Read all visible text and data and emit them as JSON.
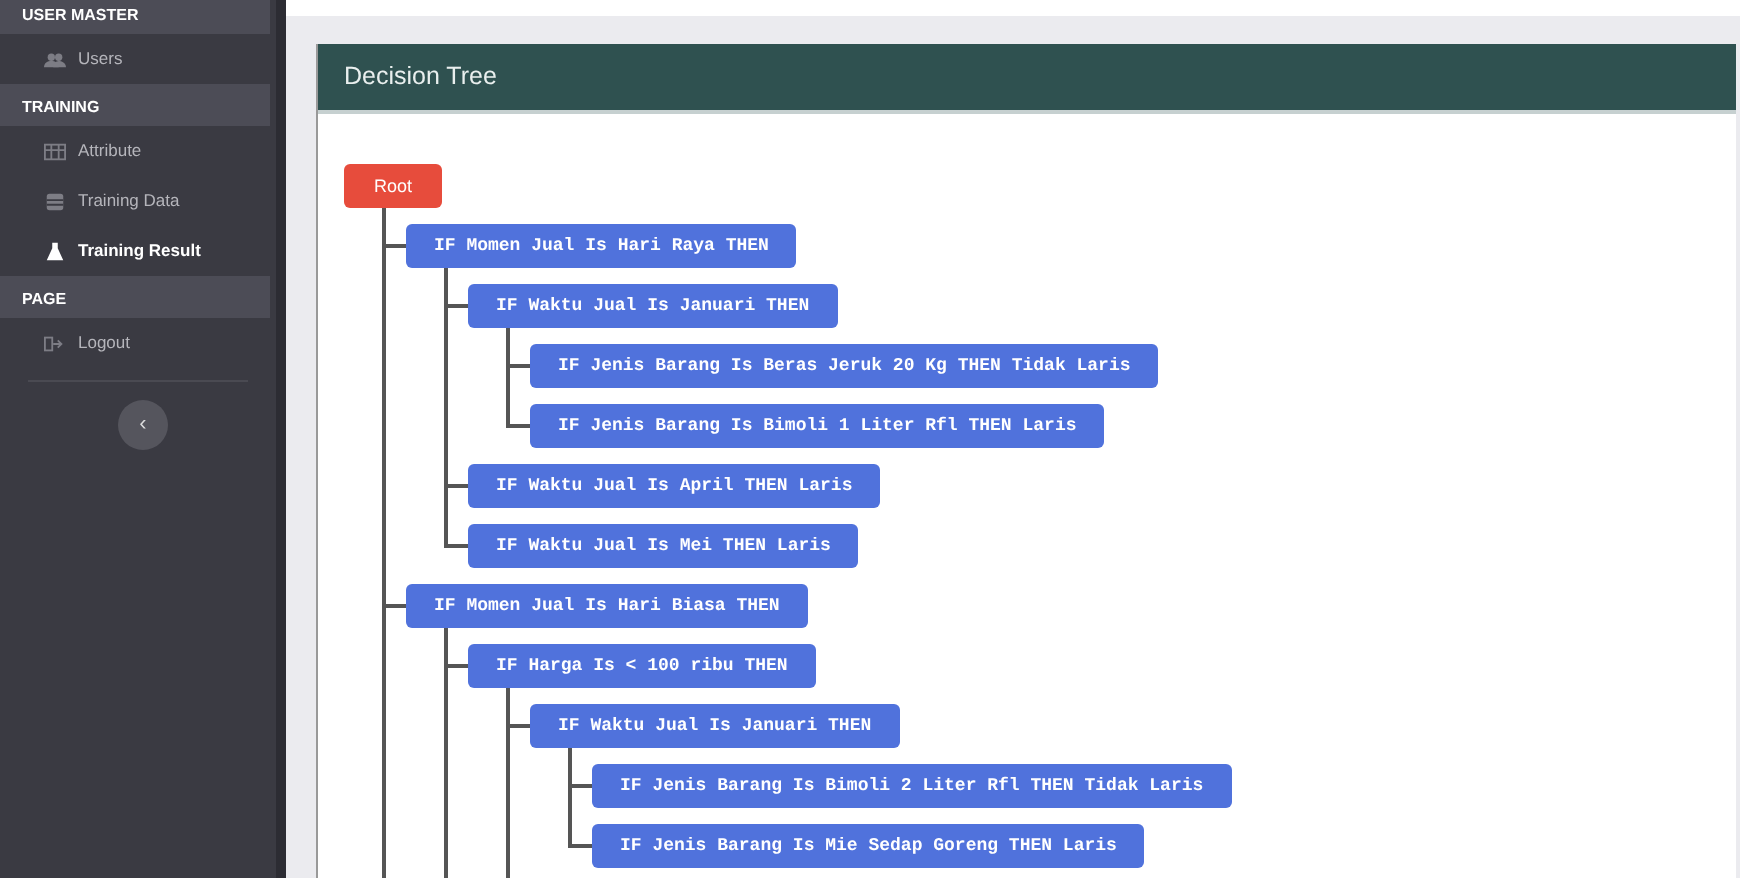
{
  "sidebar": {
    "sections": [
      {
        "heading": "USER MASTER",
        "items": [
          {
            "label": "Users",
            "selected": false
          }
        ]
      },
      {
        "heading": "TRAINING",
        "items": [
          {
            "label": "Attribute",
            "selected": false
          },
          {
            "label": "Training Data",
            "selected": false
          },
          {
            "label": "Training Result",
            "selected": true
          }
        ]
      },
      {
        "heading": "PAGE",
        "items": [
          {
            "label": "Logout",
            "selected": false
          }
        ]
      }
    ],
    "toggle": "‹"
  },
  "card": {
    "title": "Decision Tree",
    "tree": {
      "label": "Root",
      "kind": "root",
      "continues": true,
      "children": [
        {
          "label": "IF Momen Jual Is Hari Raya THEN",
          "kind": "rule",
          "children": [
            {
              "label": "IF Waktu Jual Is Januari THEN",
              "kind": "rule",
              "children": [
                {
                  "label": "IF Jenis Barang Is Beras Jeruk 20 Kg THEN Tidak Laris",
                  "kind": "rule"
                },
                {
                  "label": "IF Jenis Barang Is Bimoli 1 Liter Rfl THEN Laris",
                  "kind": "rule"
                }
              ]
            },
            {
              "label": "IF Waktu Jual Is April THEN Laris",
              "kind": "rule"
            },
            {
              "label": "IF Waktu Jual Is Mei THEN Laris",
              "kind": "rule"
            }
          ]
        },
        {
          "label": "IF Momen Jual Is Hari Biasa THEN",
          "kind": "rule",
          "continues": true,
          "children": [
            {
              "label": "IF Harga Is < 100 ribu THEN",
              "kind": "rule",
              "continues": true,
              "children": [
                {
                  "label": "IF Waktu Jual Is Januari THEN",
                  "kind": "rule",
                  "children": [
                    {
                      "label": "IF Jenis Barang Is Bimoli 2 Liter Rfl THEN Tidak Laris",
                      "kind": "rule"
                    },
                    {
                      "label": "IF Jenis Barang Is Mie Sedap Goreng THEN Laris",
                      "kind": "rule"
                    }
                  ]
                }
              ]
            }
          ]
        }
      ]
    }
  }
}
